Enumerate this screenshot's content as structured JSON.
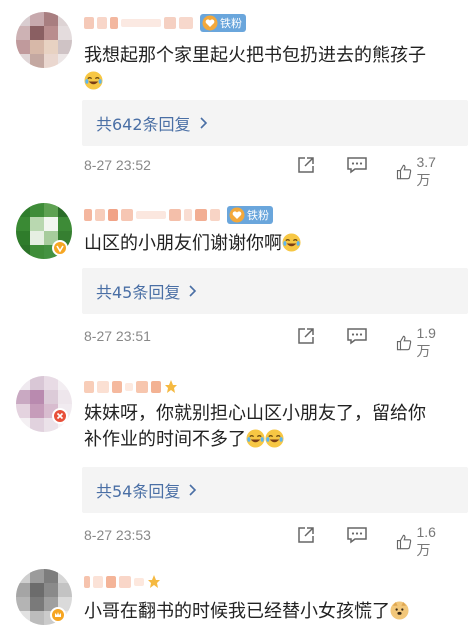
{
  "colors": {
    "link_blue": "#4a6fa5",
    "reply_box_bg": "#f4f4f4",
    "fan_badge_bg": "#6aa6dc",
    "timestamp_gray": "#888888"
  },
  "comments": [
    {
      "text": "我想起那个家里起火把书包扔进去的熊孩子",
      "has_fan_badge": true,
      "fan_badge_label": "铁粉",
      "emoji": [
        "laugh-cry-emoji"
      ],
      "replies_label": "共642条回复",
      "timestamp": "8-27 23:52",
      "likes": "3.7万"
    },
    {
      "text": "山区的小朋友们谢谢你啊",
      "has_fan_badge": true,
      "fan_badge_label": "铁粉",
      "emoji": [
        "laugh-cry-emoji"
      ],
      "replies_label": "共45条回复",
      "timestamp": "8-27 23:51",
      "likes": "1.9万"
    },
    {
      "text_line1": "妹妹呀，你就别担心山区小朋友了，留给你",
      "text_line2": "补作业的时间不多了",
      "has_fan_badge": false,
      "emoji": [
        "laugh-cry-emoji",
        "laugh-cry-emoji"
      ],
      "replies_label": "共54条回复",
      "timestamp": "8-27 23:53",
      "likes": "1.6万"
    },
    {
      "text": "小哥在翻书的时候我已经替小女孩慌了",
      "has_fan_badge": false,
      "emoji": [
        "doge-emoji"
      ]
    }
  ]
}
